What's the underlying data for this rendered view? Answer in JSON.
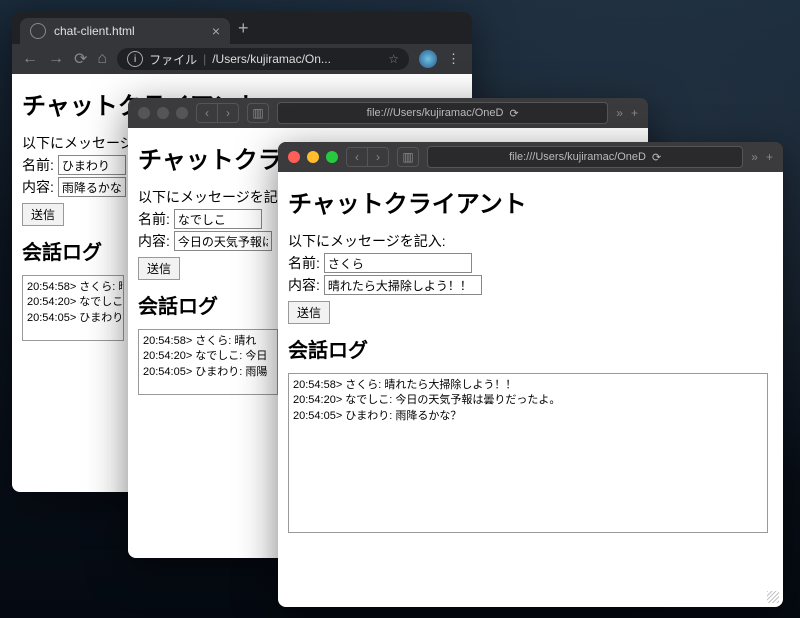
{
  "chrome": {
    "tab_title": "chat-client.html",
    "addr_prefix": "ファイル",
    "addr_path": "/Users/kujiramac/On..."
  },
  "safariA": {
    "url": "file:///Users/kujiramac/OneD"
  },
  "safariB": {
    "url": "file:///Users/kujiramac/OneD"
  },
  "app": {
    "title": "チャットクライアント",
    "prompt": "以下にメッセージを記入:",
    "name_label": "名前:",
    "body_label": "内容:",
    "send_label": "送信",
    "log_title": "会話ログ"
  },
  "sessions": {
    "chromeWin": {
      "name_value": "ひまわり",
      "body_value": "雨降るかな?",
      "log": [
        "20:54:58> さくら: 晴",
        "20:54:20> なでしこ",
        "20:54:05> ひまわり"
      ]
    },
    "safA": {
      "name_value": "なでしこ",
      "body_value": "今日の天気予報は",
      "log": [
        "20:54:58> さくら: 晴れ",
        "20:54:20> なでしこ: 今日",
        "20:54:05> ひまわり: 雨陽"
      ]
    },
    "safB": {
      "name_value": "さくら",
      "body_value": "晴れたら大掃除しよう！！",
      "log": [
        "20:54:58> さくら: 晴れたら大掃除しよう！！",
        "20:54:20> なでしこ: 今日の天気予報は曇りだったよ。",
        "20:54:05> ひまわり: 雨降るかな？"
      ]
    }
  }
}
